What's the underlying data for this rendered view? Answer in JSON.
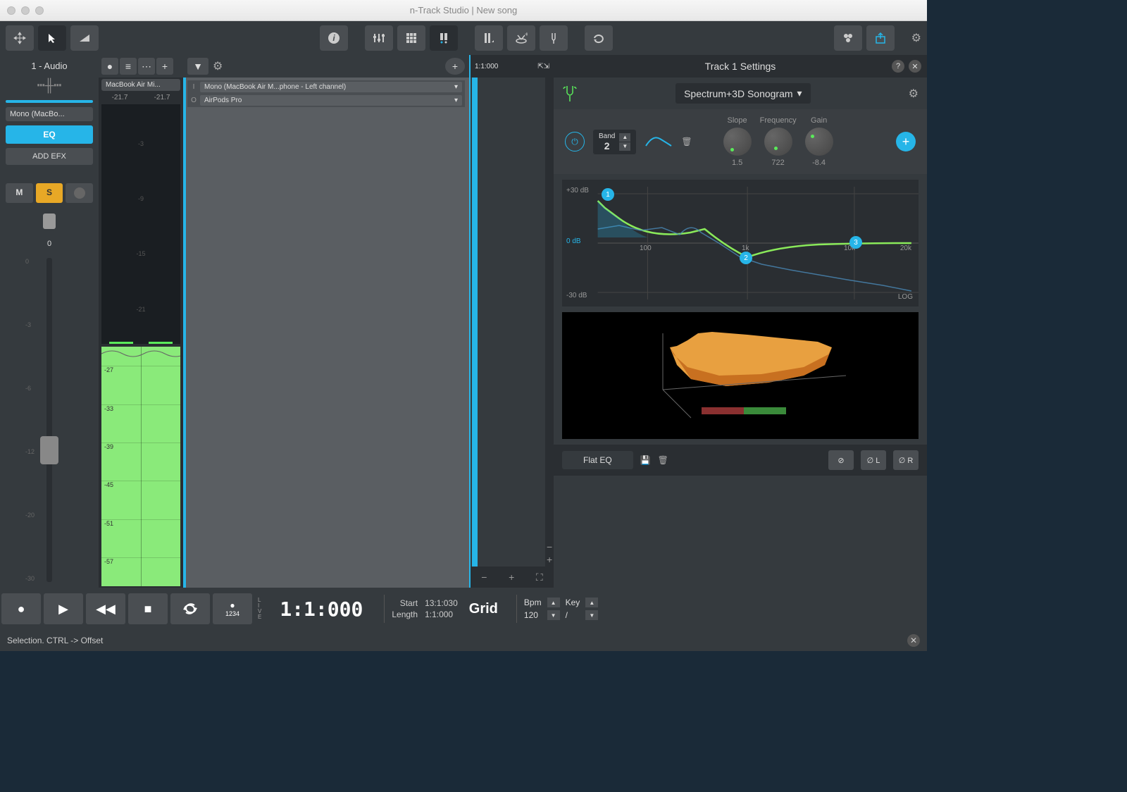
{
  "window": {
    "title": "n-Track Studio | New song"
  },
  "track": {
    "name": "1 - Audio",
    "input": "Mono (MacBo...",
    "inputFull": "MacBook Air Mi...",
    "eq": "EQ",
    "addEfx": "ADD EFX",
    "mute": "M",
    "solo": "S",
    "pan": "0",
    "faderTicks": [
      "0",
      "-3",
      "-6",
      "-12",
      "-20",
      "-30"
    ]
  },
  "meter": {
    "dbL": "-21.7",
    "dbR": "-21.7",
    "ticks": [
      "-3",
      "-9",
      "-15",
      "-21"
    ],
    "waveTicks": [
      "-27",
      "-33",
      "-39",
      "-45",
      "-51",
      "-57"
    ]
  },
  "routing": {
    "inLabel": "I",
    "inValue": "Mono (MacBook Air M...phone - Left channel)",
    "outLabel": "O",
    "outValue": "AirPods Pro"
  },
  "timeline": {
    "pos": "1:1:000"
  },
  "settings": {
    "title": "Track 1 Settings",
    "mode": "Spectrum+3D Sonogram",
    "band": {
      "label": "Band",
      "value": "2"
    },
    "knobs": {
      "slope": {
        "label": "Slope",
        "value": "1.5"
      },
      "freq": {
        "label": "Frequency",
        "value": "722"
      },
      "gain": {
        "label": "Gain",
        "value": "-8.4"
      }
    },
    "eqYLabels": [
      "+30 dB",
      "0 dB",
      "-30 dB"
    ],
    "eqXLabels": [
      "100",
      "1k",
      "10k",
      "20k"
    ],
    "eqLog": "LOG",
    "eqPoints": [
      "1",
      "2",
      "3"
    ],
    "flat": "Flat EQ",
    "phaseL": "∅ L",
    "phaseR": "∅ R"
  },
  "transport": {
    "time": "1:1:000",
    "live": "LIVE",
    "count": "1234",
    "start": {
      "label": "Start",
      "value": "13:1:030"
    },
    "length": {
      "label": "Length",
      "value": "1:1:000"
    },
    "grid": "Grid",
    "bpm": {
      "label": "Bpm",
      "value": "120"
    },
    "key": {
      "label": "Key",
      "value": "/"
    }
  },
  "status": "Selection. CTRL -> Offset"
}
